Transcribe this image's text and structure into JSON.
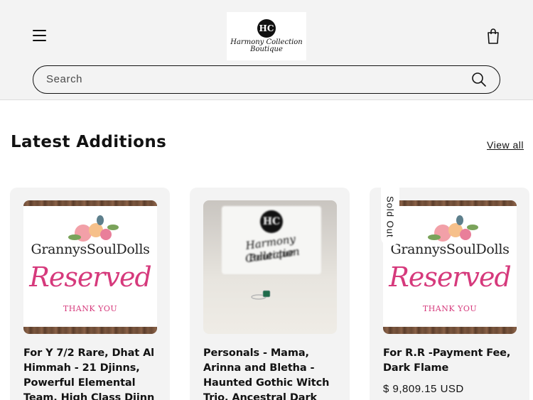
{
  "header": {
    "logo_mark": "HC",
    "logo_line1": "Harmony Collection",
    "logo_line2": "Boutique",
    "menu_icon": "hamburger-menu-icon",
    "cart_icon": "shopping-bag-icon"
  },
  "search": {
    "placeholder": "Search",
    "icon": "search-icon"
  },
  "section": {
    "title": "Latest Additions",
    "view_all": "View all"
  },
  "products": [
    {
      "title": "For Y 7/2 Rare, Dhat Al Himmah - 21 Djinns, Powerful Elemental Team, High Class Djinn",
      "image_brand": "GrannysSoulDolls",
      "image_reserved": "Reserved",
      "image_thanks": "THANK YOU"
    },
    {
      "title": "Personals - Mama, Arinna and Bletha - Haunted Gothic Witch Trio, Ancestral Dark",
      "image_mark": "HC",
      "image_line1": "Harmony Collection",
      "image_line2": "Boutique"
    },
    {
      "title": "For R.R -Payment Fee, Dark Flame",
      "price": "$ 9,809.15 USD",
      "badge": "Sold Out",
      "image_brand": "GrannysSoulDolls",
      "image_reserved": "Reserved",
      "image_thanks": "THANK YOU"
    }
  ],
  "colors": {
    "header_bg": "#f3f3f3",
    "text": "#121212",
    "reserved_pink": "#d63a7c"
  }
}
